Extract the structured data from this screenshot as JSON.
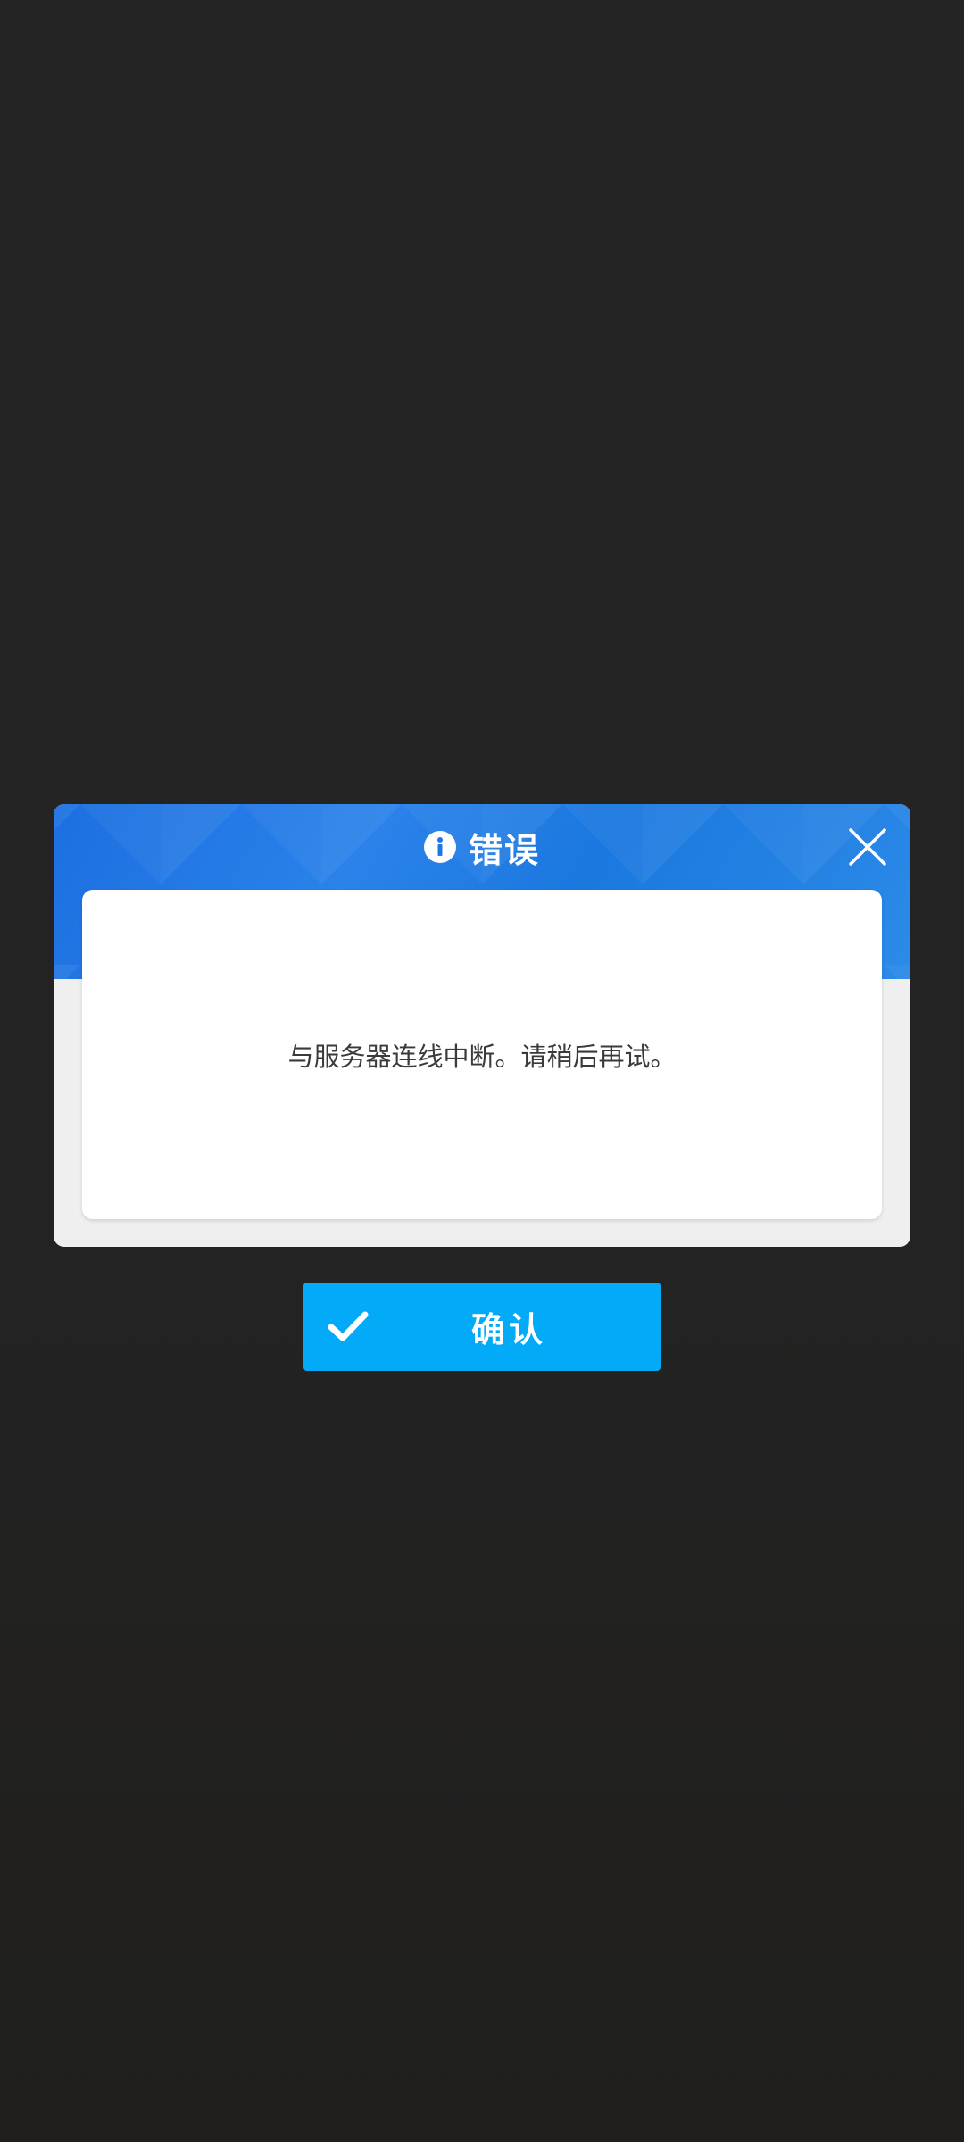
{
  "dialog": {
    "title": "错误",
    "title_icon": "info-icon",
    "close_icon": "close-icon",
    "message": "与服务器连线中断。请稍后再试。"
  },
  "confirm": {
    "icon": "checkmark-icon",
    "label": "确认"
  },
  "colors": {
    "background": "#232323",
    "header_blue": "#1c78e2",
    "button_blue": "#02aaf8",
    "panel": "#efefef",
    "body": "#ffffff",
    "message_text": "#3a3a3a"
  }
}
